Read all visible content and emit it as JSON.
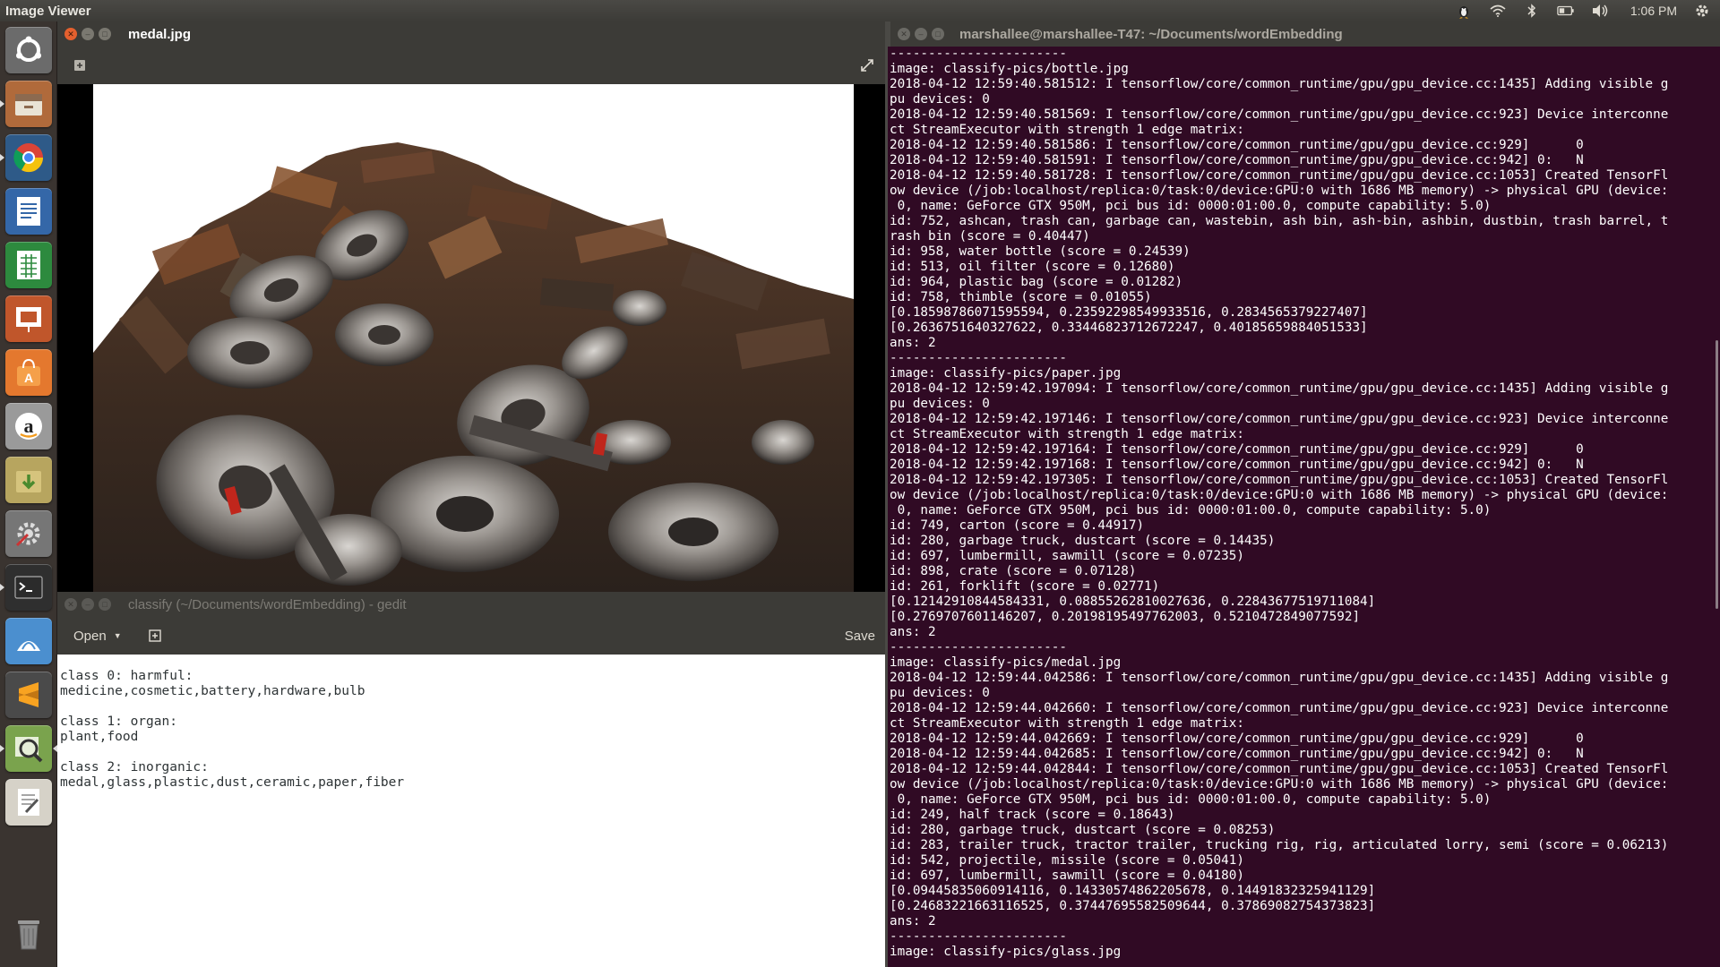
{
  "top_panel": {
    "app_title": "Image Viewer",
    "clock": "1:06 PM"
  },
  "launcher": {
    "items": [
      {
        "name": "ubuntu-dash-icon",
        "color": "#6b6b6b"
      },
      {
        "name": "files-icon",
        "color": "#b06a3b"
      },
      {
        "name": "chrome-icon",
        "color": "#2e5a88"
      },
      {
        "name": "writer-icon",
        "color": "#3467a8"
      },
      {
        "name": "calc-icon",
        "color": "#2d8a3e"
      },
      {
        "name": "impress-icon",
        "color": "#c0562b"
      },
      {
        "name": "software-center-icon",
        "color": "#e4782e"
      },
      {
        "name": "amazon-icon",
        "color": "#9a9a9a"
      },
      {
        "name": "archive-icon",
        "color": "#b7a55f"
      },
      {
        "name": "system-settings-icon",
        "color": "#767676"
      },
      {
        "name": "terminal-icon",
        "color": "#2f2f2f"
      },
      {
        "name": "word-icon",
        "color": "#4b8fcf"
      },
      {
        "name": "sublime-icon",
        "color": "#4a4a4a"
      },
      {
        "name": "image-viewer-icon",
        "color": "#7aa34d"
      },
      {
        "name": "text-editor-icon",
        "color": "#d6d2c8"
      }
    ],
    "trash": {
      "name": "trash-icon"
    }
  },
  "viewer": {
    "title": "medal.jpg"
  },
  "gedit": {
    "title": "classify (~/Documents/wordEmbedding) - gedit",
    "open_label": "Open",
    "save_label": "Save",
    "lines": [
      "class 0: harmful:",
      "medicine,cosmetic,battery,hardware,bulb",
      "",
      "class 1: organ:",
      "plant,food",
      "",
      "class 2: inorganic:",
      "medal,glass,plastic,dust,ceramic,paper,fiber"
    ]
  },
  "terminal": {
    "title": "marshallee@marshallee-T47: ~/Documents/wordEmbedding",
    "lines": [
      "-----------------------",
      "image: classify-pics/bottle.jpg",
      "2018-04-12 12:59:40.581512: I tensorflow/core/common_runtime/gpu/gpu_device.cc:1435] Adding visible g",
      "pu devices: 0",
      "2018-04-12 12:59:40.581569: I tensorflow/core/common_runtime/gpu/gpu_device.cc:923] Device interconne",
      "ct StreamExecutor with strength 1 edge matrix:",
      "2018-04-12 12:59:40.581586: I tensorflow/core/common_runtime/gpu/gpu_device.cc:929]      0",
      "2018-04-12 12:59:40.581591: I tensorflow/core/common_runtime/gpu/gpu_device.cc:942] 0:   N",
      "2018-04-12 12:59:40.581728: I tensorflow/core/common_runtime/gpu/gpu_device.cc:1053] Created TensorFl",
      "ow device (/job:localhost/replica:0/task:0/device:GPU:0 with 1686 MB memory) -> physical GPU (device:",
      " 0, name: GeForce GTX 950M, pci bus id: 0000:01:00.0, compute capability: 5.0)",
      "id: 752, ashcan, trash can, garbage can, wastebin, ash bin, ash-bin, ashbin, dustbin, trash barrel, t",
      "rash bin (score = 0.40447)",
      "id: 958, water bottle (score = 0.24539)",
      "id: 513, oil filter (score = 0.12680)",
      "id: 964, plastic bag (score = 0.01282)",
      "id: 758, thimble (score = 0.01055)",
      "[0.18598786071595594, 0.23592298549933516, 0.2834565379227407]",
      "[0.2636751640327622, 0.33446823712672247, 0.40185659884051533]",
      "ans: 2",
      "-----------------------",
      "image: classify-pics/paper.jpg",
      "2018-04-12 12:59:42.197094: I tensorflow/core/common_runtime/gpu/gpu_device.cc:1435] Adding visible g",
      "pu devices: 0",
      "2018-04-12 12:59:42.197146: I tensorflow/core/common_runtime/gpu/gpu_device.cc:923] Device interconne",
      "ct StreamExecutor with strength 1 edge matrix:",
      "2018-04-12 12:59:42.197164: I tensorflow/core/common_runtime/gpu/gpu_device.cc:929]      0",
      "2018-04-12 12:59:42.197168: I tensorflow/core/common_runtime/gpu/gpu_device.cc:942] 0:   N",
      "2018-04-12 12:59:42.197305: I tensorflow/core/common_runtime/gpu/gpu_device.cc:1053] Created TensorFl",
      "ow device (/job:localhost/replica:0/task:0/device:GPU:0 with 1686 MB memory) -> physical GPU (device:",
      " 0, name: GeForce GTX 950M, pci bus id: 0000:01:00.0, compute capability: 5.0)",
      "id: 749, carton (score = 0.44917)",
      "id: 280, garbage truck, dustcart (score = 0.14435)",
      "id: 697, lumbermill, sawmill (score = 0.07235)",
      "id: 898, crate (score = 0.07128)",
      "id: 261, forklift (score = 0.02771)",
      "[0.12142910844584331, 0.08855262810027636, 0.22843677519711084]",
      "[0.2769707601146207, 0.20198195497762003, 0.5210472849077592]",
      "ans: 2",
      "-----------------------",
      "image: classify-pics/medal.jpg",
      "2018-04-12 12:59:44.042586: I tensorflow/core/common_runtime/gpu/gpu_device.cc:1435] Adding visible g",
      "pu devices: 0",
      "2018-04-12 12:59:44.042660: I tensorflow/core/common_runtime/gpu/gpu_device.cc:923] Device interconne",
      "ct StreamExecutor with strength 1 edge matrix:",
      "2018-04-12 12:59:44.042669: I tensorflow/core/common_runtime/gpu/gpu_device.cc:929]      0",
      "2018-04-12 12:59:44.042685: I tensorflow/core/common_runtime/gpu/gpu_device.cc:942] 0:   N",
      "2018-04-12 12:59:44.042844: I tensorflow/core/common_runtime/gpu/gpu_device.cc:1053] Created TensorFl",
      "ow device (/job:localhost/replica:0/task:0/device:GPU:0 with 1686 MB memory) -> physical GPU (device:",
      " 0, name: GeForce GTX 950M, pci bus id: 0000:01:00.0, compute capability: 5.0)",
      "id: 249, half track (score = 0.18643)",
      "id: 280, garbage truck, dustcart (score = 0.08253)",
      "id: 283, trailer truck, tractor trailer, trucking rig, rig, articulated lorry, semi (score = 0.06213)",
      "id: 542, projectile, missile (score = 0.05041)",
      "id: 697, lumbermill, sawmill (score = 0.04180)",
      "[0.09445835060914116, 0.14330574862205678, 0.14491832325941129]",
      "[0.24683221663116525, 0.37447695582509644, 0.37869082754373823]",
      "ans: 2",
      "-----------------------",
      "image: classify-pics/glass.jpg"
    ]
  }
}
